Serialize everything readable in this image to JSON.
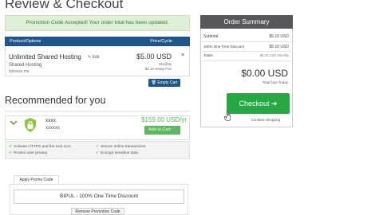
{
  "page": {
    "title": "Review & Checkout"
  },
  "alert": {
    "text": "Promotion Code Accepted! Your order total has been updated."
  },
  "cart_table": {
    "col_product": "Product/Options",
    "col_price": "Price/Cycle",
    "item": {
      "name": "Unlimited Shared Hosting",
      "edit_label": "Edit",
      "group": "Shared Hosting",
      "domain": "bdnews.me",
      "price": "$5.00 USD",
      "cycle": "Monthly",
      "setup_fee": "$0.10 Setup Fee",
      "remove_label": "×"
    },
    "empty_cart_label": "Empty Cart"
  },
  "recommended": {
    "title": "Recommended for you",
    "item": {
      "name": "xxxx",
      "sub": "xxxxxx",
      "price": "$159.00 USD/yr",
      "add_label": "Add to Cart"
    },
    "features": [
      "Activate HTTPS and the lock icon",
      "Secure online transactions",
      "Protect user privacy",
      "Encrypt sensitive data"
    ]
  },
  "promo": {
    "tab_label": "Apply Promo Code",
    "applied": "BIPUL - 100% One Time Discount",
    "remove_label": "Remove Promotion Code"
  },
  "summary": {
    "title": "Order Summary",
    "subtotal_label": "Subtotal",
    "subtotal_value": "$5.10 USD",
    "discount_label": "100% One Time Discount",
    "discount_value": "$5.10 USD",
    "totals_label": "Totals",
    "totals_value": "$0.00 USD Monthly",
    "total": "$0.00 USD",
    "total_due_label": "Total Due Today",
    "checkout_label": "Checkout",
    "continue_label": "Continue Shopping"
  },
  "colors": {
    "header_blue": "#1f568a",
    "success_green": "#28a745",
    "summary_header": "#58585a"
  }
}
